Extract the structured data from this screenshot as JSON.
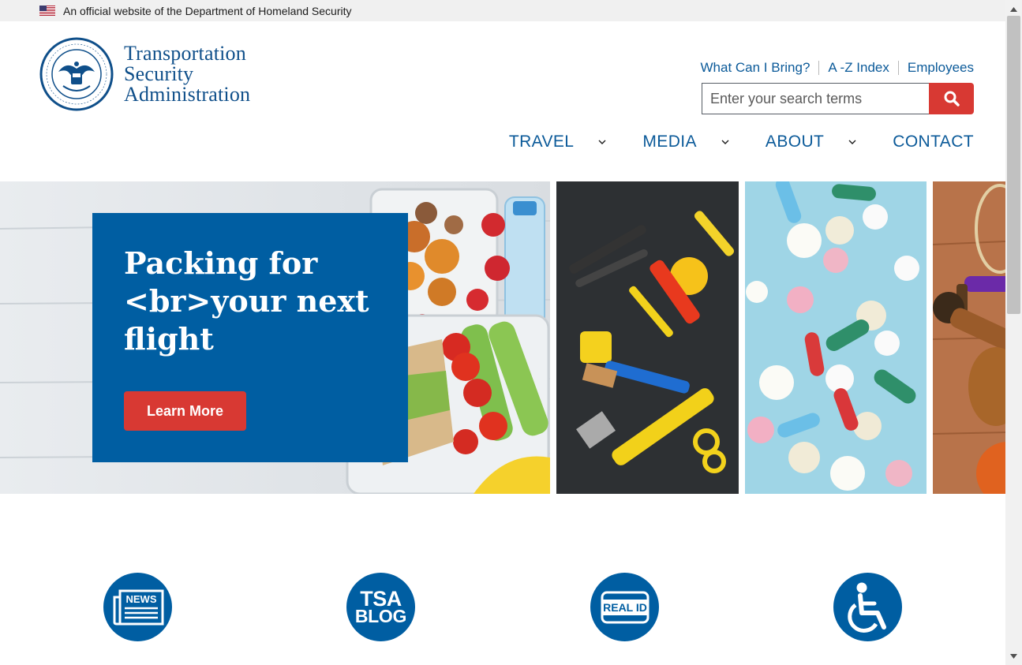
{
  "gov_banner": {
    "text": "An official website of the Department of Homeland Security",
    "flag_icon": "us-flag-icon"
  },
  "header": {
    "agency_lines": [
      "Transportation",
      "Security",
      "Administration"
    ],
    "seal_icon": "dhs-seal-icon",
    "util_links": [
      "What Can I Bring?",
      "A -Z Index",
      "Employees"
    ],
    "search": {
      "placeholder": "Enter your search terms",
      "value": "",
      "button_icon": "search-icon"
    },
    "nav": [
      {
        "label": "TRAVEL",
        "has_dropdown": true
      },
      {
        "label": "MEDIA",
        "has_dropdown": true
      },
      {
        "label": "ABOUT",
        "has_dropdown": true
      },
      {
        "label": "CONTACT",
        "has_dropdown": false
      }
    ]
  },
  "hero": {
    "title": "Packing for <br>your next flight",
    "button": "Learn More",
    "panels": [
      "food-container-image",
      "tools-image",
      "pills-image",
      "sports-equipment-image"
    ]
  },
  "quick_links": [
    {
      "icon": "newspaper-icon",
      "icon_text": "NEWS"
    },
    {
      "icon": "tsa-blog-icon",
      "icon_text_1": "TSA",
      "icon_text_2": "BLOG"
    },
    {
      "icon": "real-id-icon",
      "icon_text": "REAL ID"
    },
    {
      "icon": "wheelchair-icon"
    }
  ],
  "colors": {
    "primary_blue": "#005ea2",
    "link_blue": "#0b5a99",
    "accent_red": "#d83933",
    "banner_gray": "#f0f0f0"
  }
}
